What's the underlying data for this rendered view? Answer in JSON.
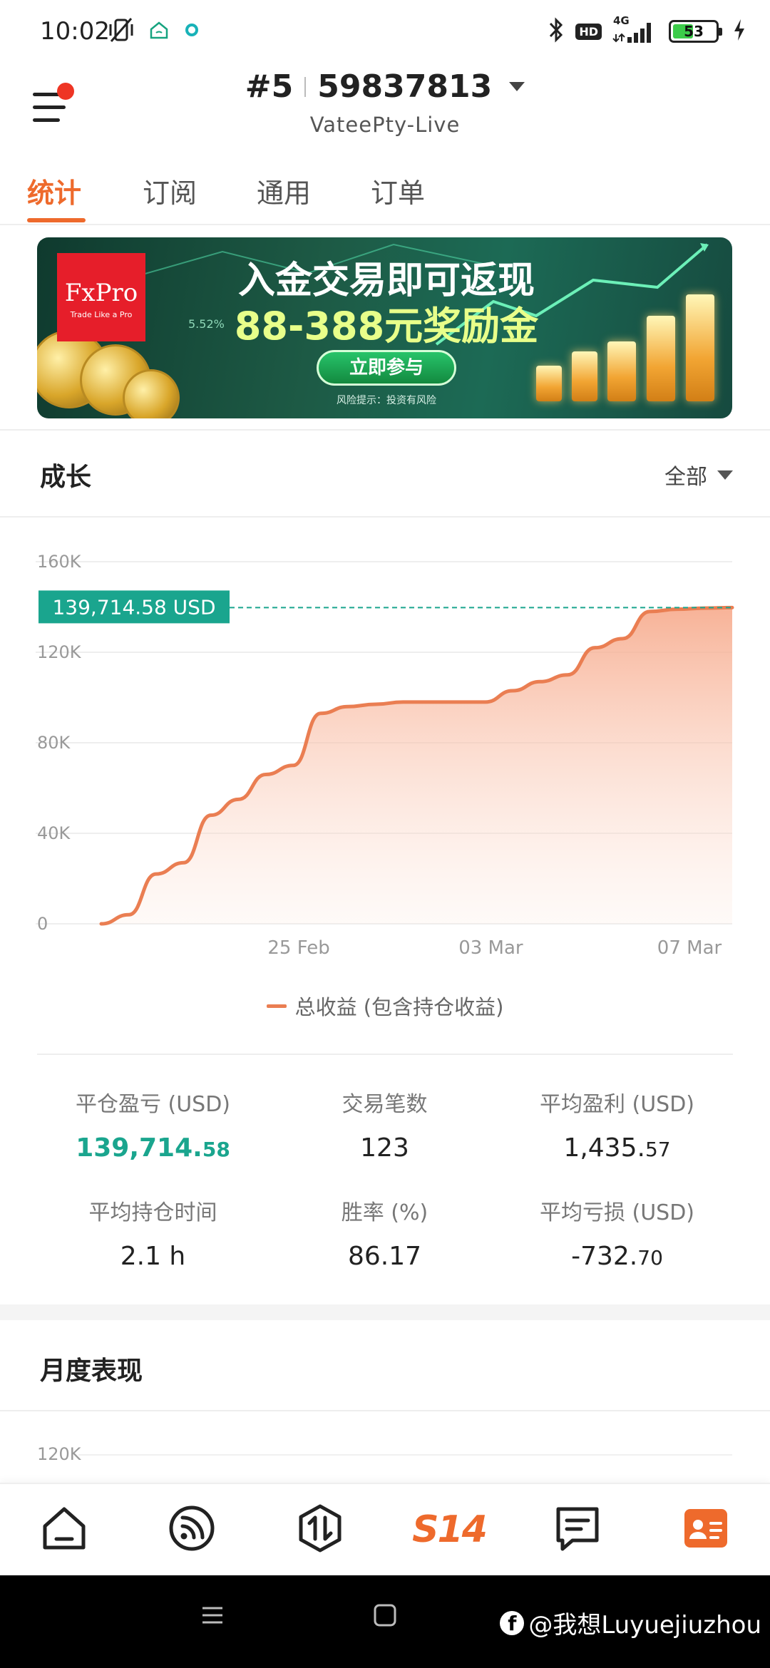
{
  "status_bar": {
    "time": "10:02",
    "network": "4G",
    "hd_badge": "HD",
    "battery": "53",
    "battery_level": 0.53,
    "icons": [
      "vibrate-off-icon",
      "home-wifi-icon",
      "app-dot-icon",
      "bluetooth-icon",
      "signal-icon",
      "charging-icon"
    ]
  },
  "header": {
    "account_prefix": "#5",
    "account_number": "59837813",
    "server": "VateePty-Live",
    "menu_icon": "menu-icon",
    "notification_dot_color": "#ee3524"
  },
  "tabs": [
    {
      "label": "统计",
      "active": true
    },
    {
      "label": "订阅",
      "active": false
    },
    {
      "label": "通用",
      "active": false
    },
    {
      "label": "订单",
      "active": false
    }
  ],
  "banner": {
    "logo_name": "FxPro",
    "logo_tagline": "Trade Like a Pro",
    "percent_text": "5.52%",
    "title": "入金交易即可返现",
    "subtitle": "88-388元奖励金",
    "cta": "立即参与",
    "risk_note": "风险提示：投资有风险"
  },
  "growth": {
    "title": "成长",
    "filter": "全部"
  },
  "chart_data": {
    "type": "area",
    "title": "",
    "xlabel": "",
    "ylabel": "",
    "ylim": [
      0,
      160000
    ],
    "yticks": [
      0,
      40000,
      80000,
      120000,
      160000
    ],
    "ytick_labels": [
      "0",
      "40K",
      "80K",
      "120K",
      "160K"
    ],
    "x_tick_labels": [
      "25 Feb",
      "03 Mar",
      "07 Mar"
    ],
    "x_tick_index": [
      7.2,
      14.2,
      22.8
    ],
    "x": [
      0,
      1,
      2,
      3,
      4,
      5,
      6,
      7,
      8,
      9,
      10,
      11,
      12,
      13,
      14,
      15,
      16,
      17,
      18,
      19,
      20,
      21,
      22,
      23
    ],
    "series": [
      {
        "name": "总收益 (包含持仓收益)",
        "color": "#ea7e52",
        "values": [
          0,
          4000,
          22000,
          27000,
          48000,
          55000,
          66000,
          70000,
          93000,
          96000,
          97000,
          98000,
          98000,
          98000,
          98000,
          103000,
          107000,
          110000,
          122000,
          126000,
          138000,
          139000,
          139500,
          139714.58
        ]
      }
    ],
    "current_value_label": "139,714.58 USD",
    "current_value": 139714.58,
    "label_color": "#1aa58e",
    "grid": true,
    "legend_position": "bottom"
  },
  "legend_label": "总收益 (包含持仓收益)",
  "stats": [
    {
      "label": "平仓盈亏 (USD)",
      "main": "139,714.",
      "small": "58",
      "positive": true
    },
    {
      "label": "交易笔数",
      "main": "123",
      "small": "",
      "positive": false
    },
    {
      "label": "平均盈利 (USD)",
      "main": "1,435.",
      "small": "57",
      "positive": false
    },
    {
      "label": "平均持仓时间",
      "main": "2.1 h",
      "small": "",
      "positive": false
    },
    {
      "label": "胜率 (%)",
      "main": "86.17",
      "small": "",
      "positive": false
    },
    {
      "label": "平均亏损 (USD)",
      "main": "-732.",
      "small": "70",
      "positive": false
    }
  ],
  "monthly": {
    "title": "月度表现",
    "axis_top_label": "120K"
  },
  "bottom_nav": {
    "items": [
      "home-icon",
      "feed-icon",
      "trade-icon",
      "s14-logo",
      "chat-icon",
      "profile-card-icon"
    ],
    "logo_text": "S14",
    "accent": "#ee6a2c"
  },
  "system_nav": {
    "watermark": "@我想Luyuejiuzhou",
    "watermark_logo": "f"
  }
}
